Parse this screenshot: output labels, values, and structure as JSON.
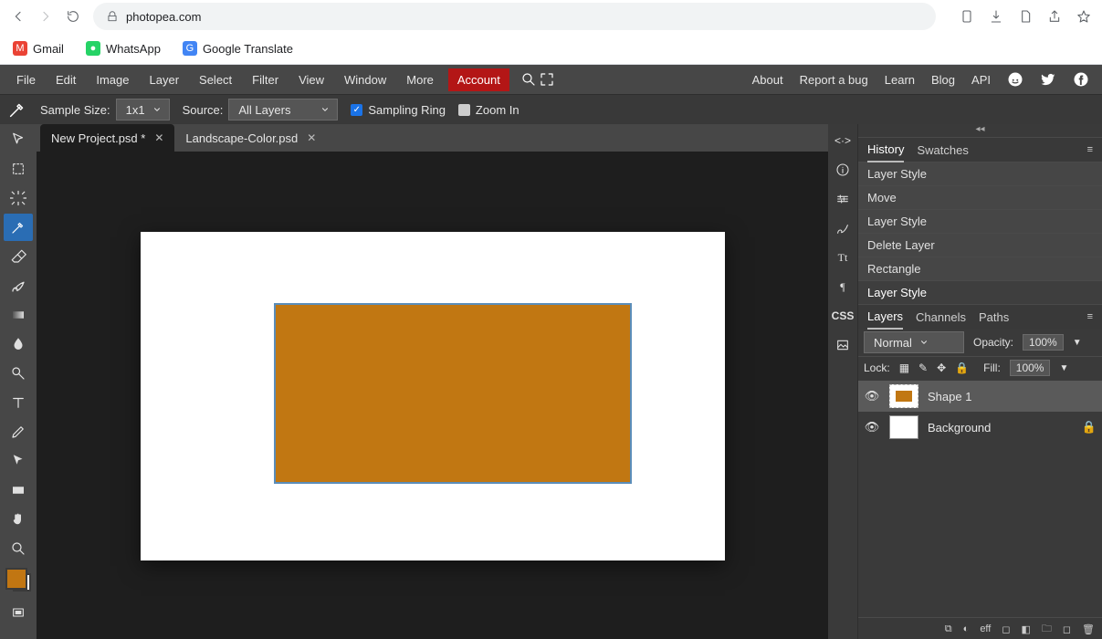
{
  "browser": {
    "url_host": "photopea.com",
    "bookmarks": [
      {
        "label": "Gmail",
        "color": "#ea4335",
        "icon": "M"
      },
      {
        "label": "WhatsApp",
        "color": "#25d366",
        "icon": "●"
      },
      {
        "label": "Google Translate",
        "color": "#4285f4",
        "icon": "G"
      }
    ]
  },
  "menu": {
    "items": [
      "File",
      "Edit",
      "Image",
      "Layer",
      "Select",
      "Filter",
      "View",
      "Window",
      "More"
    ],
    "account": "Account",
    "right": [
      "About",
      "Report a bug",
      "Learn",
      "Blog",
      "API"
    ]
  },
  "options": {
    "sample_size_label": "Sample Size:",
    "sample_size_value": "1x1",
    "source_label": "Source:",
    "source_value": "All Layers",
    "sampling_ring_label": "Sampling Ring",
    "zoom_in_label": "Zoom In"
  },
  "tabs": [
    {
      "label": "New Project.psd *",
      "active": true
    },
    {
      "label": "Landscape-Color.psd",
      "active": false
    }
  ],
  "canvas": {
    "shape_fill": "#c17712"
  },
  "panels": {
    "history_swatches_tabs": [
      "History",
      "Swatches"
    ],
    "history": [
      "Layer Style",
      "Move",
      "Layer Style",
      "Delete Layer",
      "Rectangle",
      "Layer Style"
    ],
    "history_active_index": 5,
    "layers_tabs": [
      "Layers",
      "Channels",
      "Paths"
    ],
    "layers": {
      "blend_mode": "Normal",
      "opacity_label": "Opacity:",
      "opacity_value": "100%",
      "lock_label": "Lock:",
      "fill_label": "Fill:",
      "fill_value": "100%",
      "items": [
        {
          "name": "Shape 1",
          "locked": false,
          "thumb": "shape",
          "active": true
        },
        {
          "name": "Background",
          "locked": true,
          "thumb": "bg",
          "active": false
        }
      ]
    }
  },
  "footer_icons": [
    "∞",
    "◐",
    "eff",
    "□",
    "◧",
    "🗀",
    "◻",
    "🗑"
  ]
}
